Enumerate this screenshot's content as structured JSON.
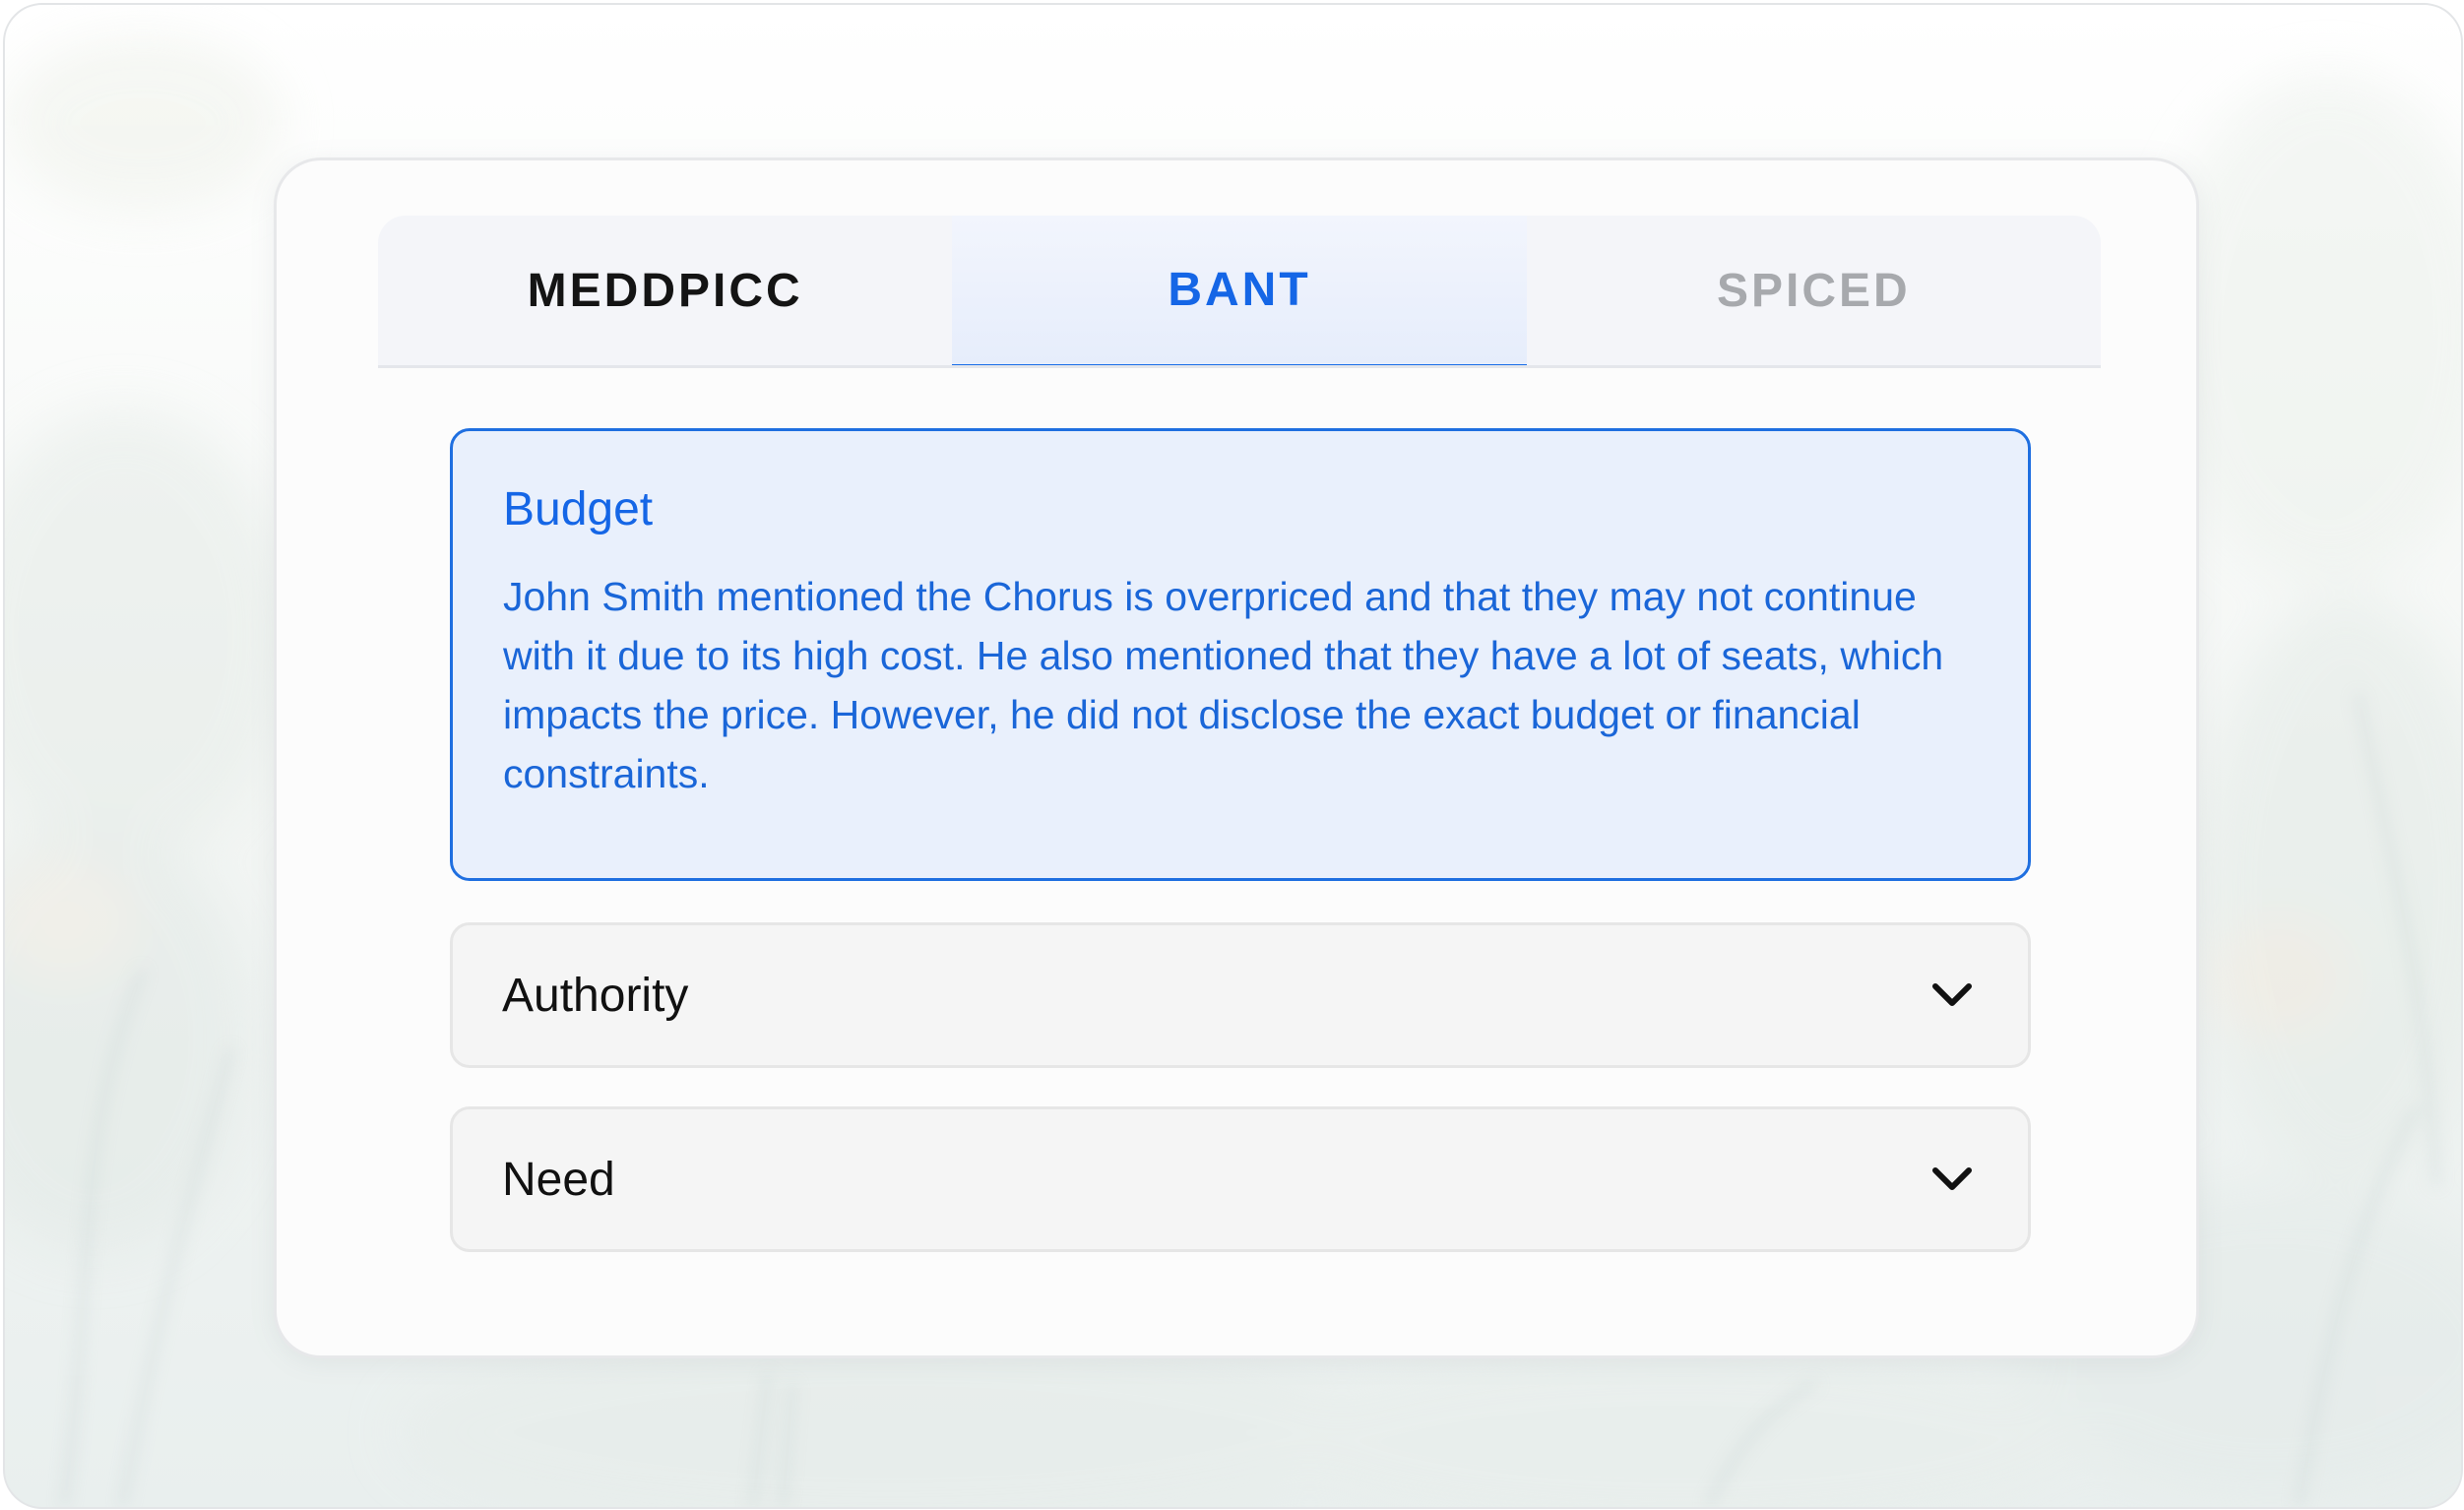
{
  "tabs": [
    {
      "label": "MEDDPICC",
      "state": "inactive"
    },
    {
      "label": "BANT",
      "state": "active"
    },
    {
      "label": "SPICED",
      "state": "disabled"
    }
  ],
  "sections": {
    "budget": {
      "title": "Budget",
      "body": "John Smith mentioned the Chorus is overpriced and that they may not continue with it due to its high cost. He also mentioned that they have a lot of seats, which impacts the price. However, he did not disclose the exact budget or financial constraints.",
      "expanded": true
    },
    "authority": {
      "title": "Authority",
      "expanded": false,
      "icon": "chevron-down-icon"
    },
    "need": {
      "title": "Need",
      "expanded": false,
      "icon": "chevron-down-icon"
    }
  },
  "colors": {
    "accent": "#1566e6",
    "active_panel_bg": "#e9f0fc",
    "disabled_tab_text": "#a7a9ad"
  }
}
